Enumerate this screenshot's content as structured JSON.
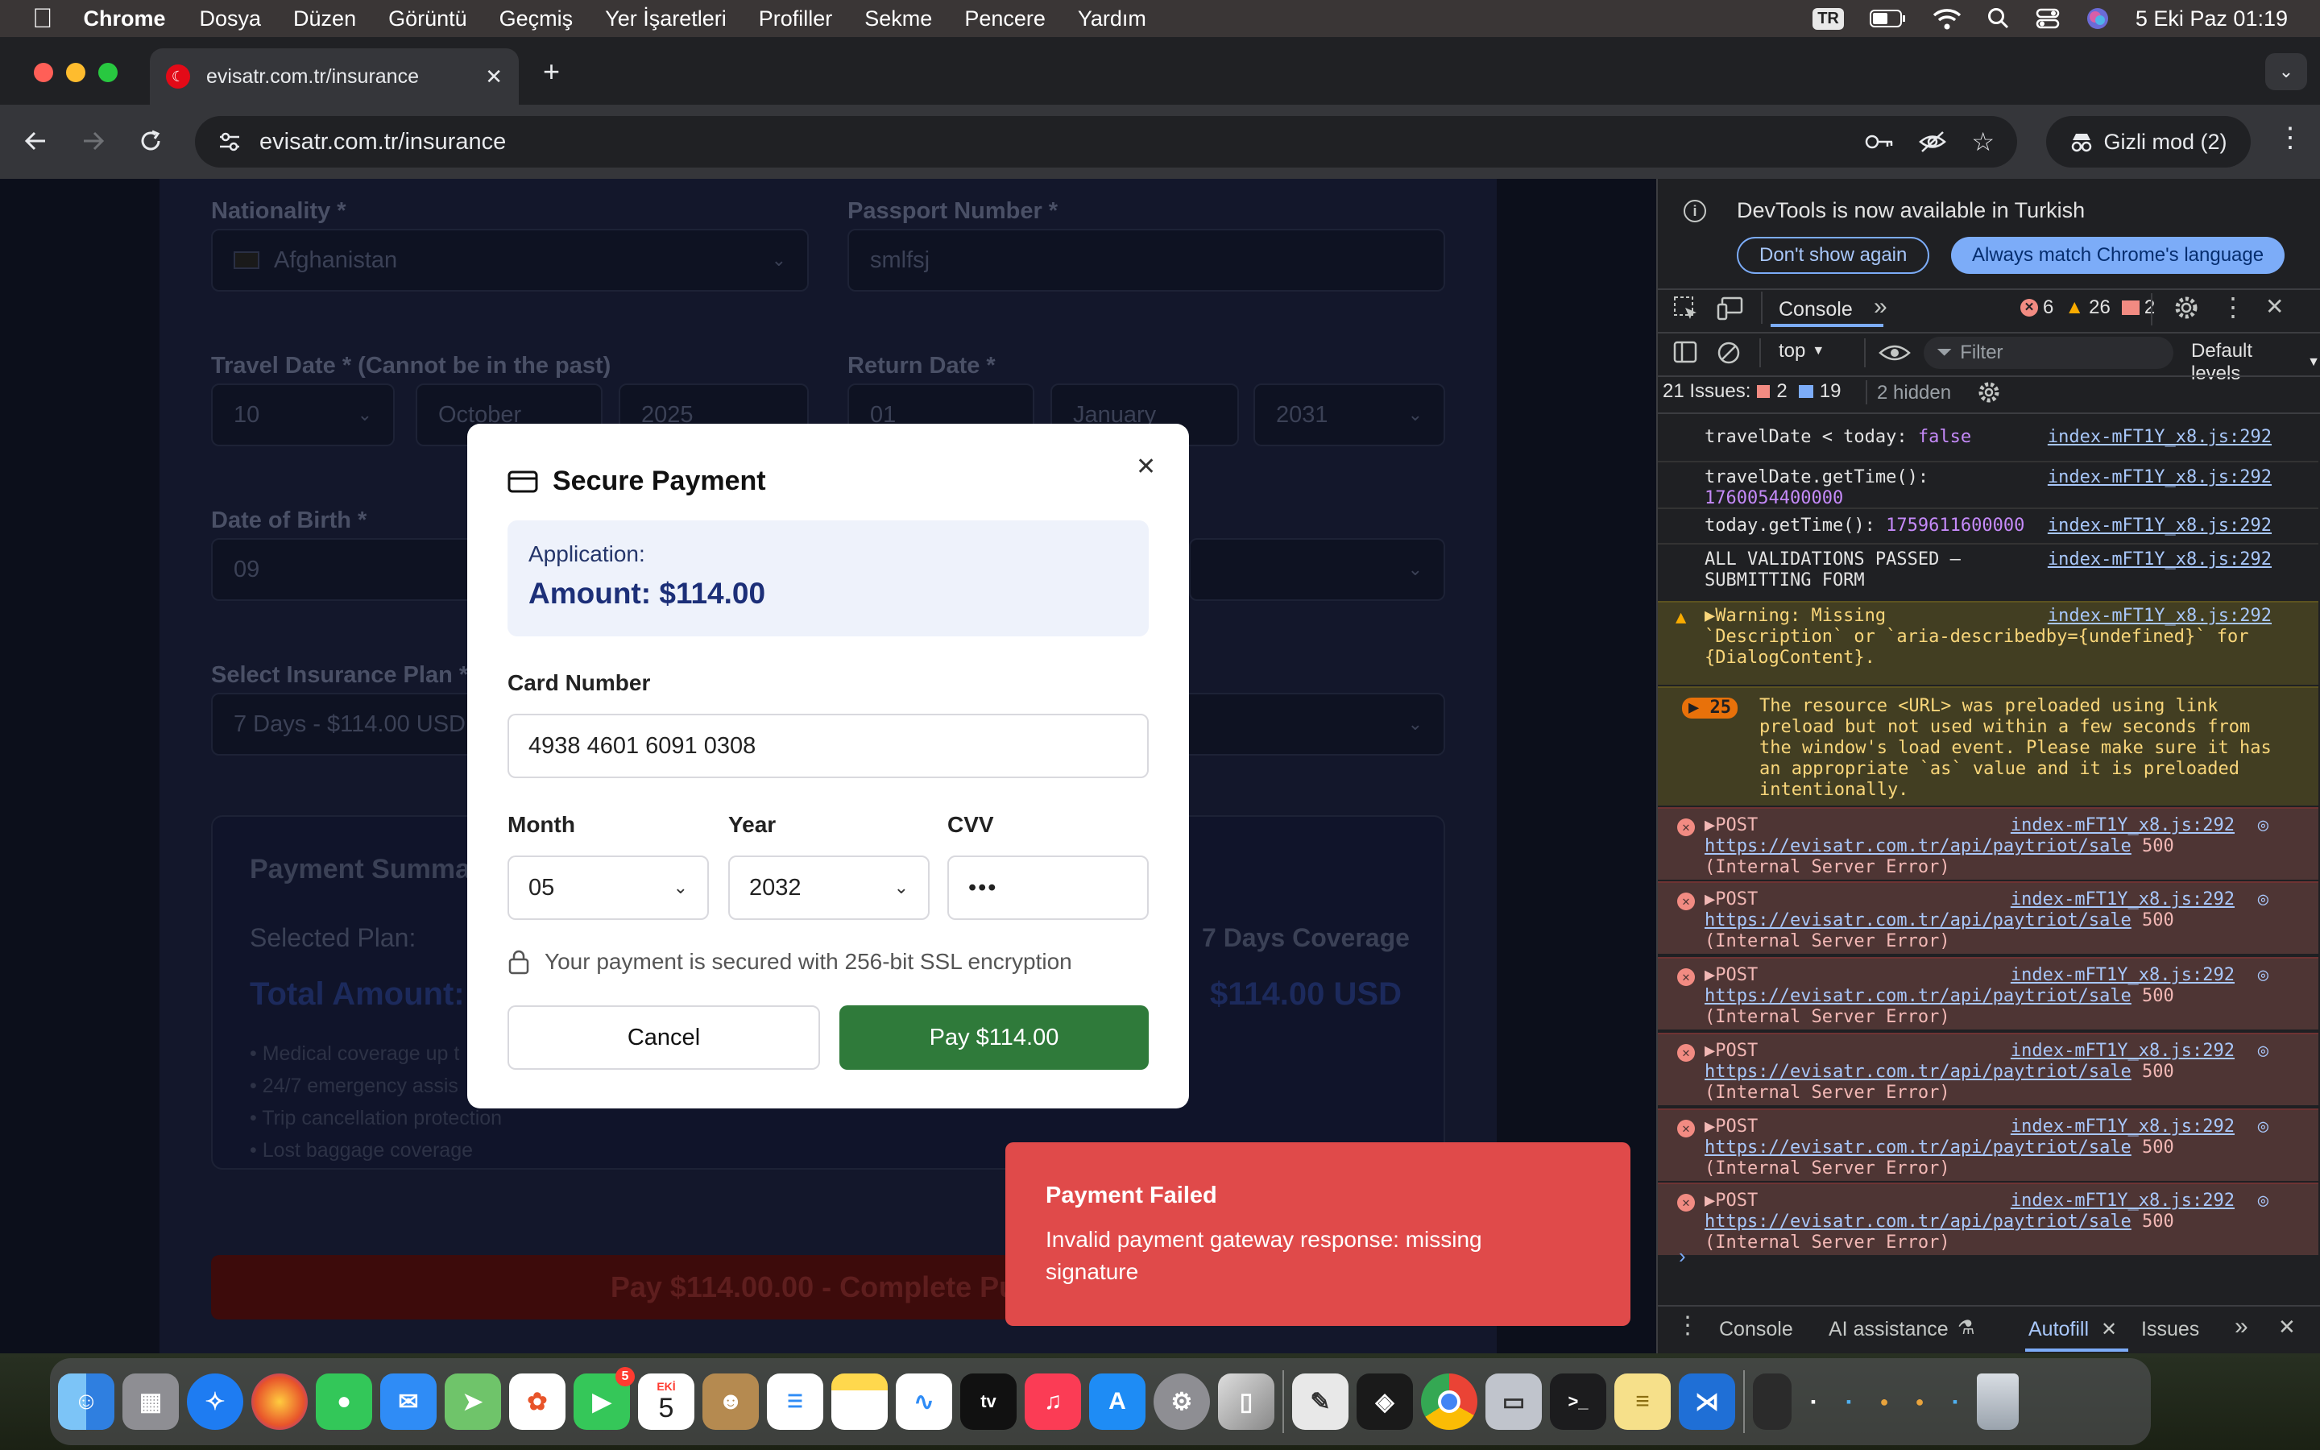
{
  "menubar": {
    "apple": "",
    "app": "Chrome",
    "items": [
      "Dosya",
      "Düzen",
      "Görüntü",
      "Geçmiş",
      "Yer İşaretleri",
      "Profiller",
      "Sekme",
      "Pencere",
      "Yardım"
    ],
    "input_source": "TR",
    "datetime": "5 Eki Paz  01:19"
  },
  "browser": {
    "tab_title": "evisatr.com.tr/insurance",
    "url": "evisatr.com.tr/insurance",
    "incognito_label": "Gizli mod (2)"
  },
  "form": {
    "nationality_label": "Nationality *",
    "nationality_value": "Afghanistan",
    "passport_label": "Passport Number *",
    "passport_value": "smlfsj",
    "travel_date_label": "Travel Date * (Cannot be in the past)",
    "travel_day": "10",
    "travel_month": "October",
    "travel_year": "2025",
    "return_date_label": "Return Date *",
    "return_day": "01",
    "return_month": "January",
    "return_year": "2031",
    "dob_label": "Date of Birth *",
    "dob_day": "09",
    "plan_label": "Select Insurance Plan *",
    "plan_value": "7 Days - $114.00 USD",
    "summary_title": "Payment Summa",
    "selected_plan_label": "Selected Plan:",
    "selected_plan_value": "7 Days Coverage",
    "total_label": "Total Amount:",
    "total_value": "$114.00 USD",
    "benefits": [
      "• Medical coverage up t",
      "• 24/7 emergency assis",
      "• Trip cancellation protection",
      "• Lost baggage coverage"
    ],
    "pay_bar_label": "Pay $114.00.00 - Complete Purc"
  },
  "modal": {
    "title": "Secure Payment",
    "app_label": "Application:",
    "amount": "Amount: $114.00",
    "card_label": "Card Number",
    "card_value": "4938 4601 6091 0308",
    "month_label": "Month",
    "month_value": "05",
    "year_label": "Year",
    "year_value": "2032",
    "cvv_label": "CVV",
    "cvv_value": "•••",
    "secure_note": "Your payment is secured with 256-bit SSL encryption",
    "cancel": "Cancel",
    "pay": "Pay $114.00"
  },
  "toast": {
    "title": "Payment Failed",
    "message": "Invalid payment gateway response: missing signature"
  },
  "devtools": {
    "banner": "DevTools is now available in Turkish",
    "dont_show": "Don't show again",
    "match_lang": "Always match Chrome's language",
    "tab_console": "Console",
    "err_count": "6",
    "warn_count": "26",
    "info_count": "2",
    "context": "top",
    "filter_placeholder": "Filter",
    "levels": "Default levels",
    "issues_label": "21 Issues:",
    "issues_err": "2",
    "issues_info": "19",
    "issues_hidden": "2 hidden",
    "logs": {
      "l1_msg": "travelDate < today: ",
      "l1_val": "false",
      "l2_msg": "travelDate.getTime():",
      "l2_val": "1760054400000",
      "l3_msg": "today.getTime(): ",
      "l3_val": "1759611600000",
      "l4_msg": "ALL VALIDATIONS PASSED –",
      "l4_msg2": "SUBMITTING FORM",
      "src": "index-mFT1Y_x8.js:292",
      "warn1": "▶Warning: Missing",
      "warn2": "`Description` or `aria-describedby={undefined}` for",
      "warn3": "{DialogContent}.",
      "group_count": "25",
      "pre1": "The resource <URL> was preloaded using link",
      "pre2": "preload but not used within a few seconds from",
      "pre3": "the window's load event. Please make sure it has",
      "pre4": "an appropriate `as` value and it is preloaded",
      "pre5": "intentionally.",
      "post": "▶POST",
      "post_url": "https://evisatr.com.tr/api/paytriot/sale",
      "post_status": " 500",
      "post_err": "(Internal Server Error)"
    },
    "prompt": "›",
    "drawer_tabs": [
      "Console",
      "AI assistance",
      "Autofill",
      "Issues"
    ]
  },
  "dock": {
    "calendar_month": "EKİ",
    "calendar_day": "5",
    "facetime_badge": "5",
    "tv_label": "tv"
  }
}
